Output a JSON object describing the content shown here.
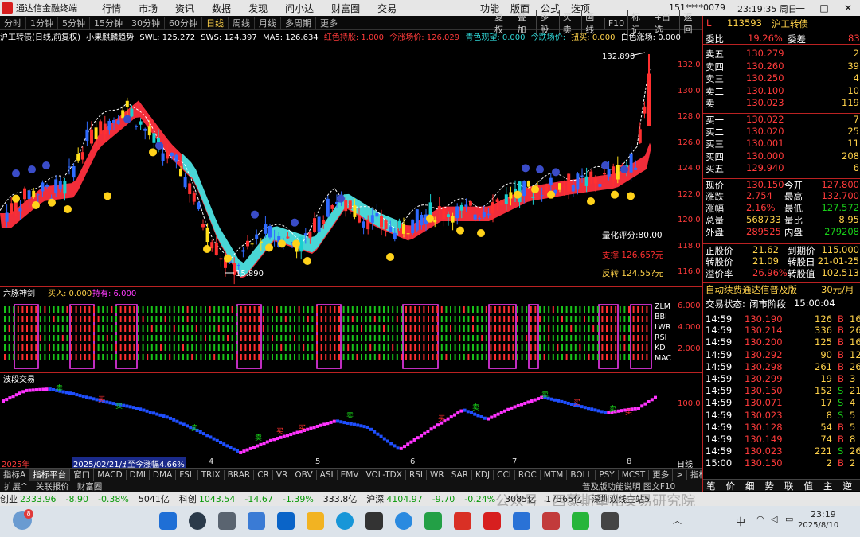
{
  "window": {
    "title": "通达信金融终端",
    "menus": [
      "行情",
      "市场",
      "资讯",
      "数据",
      "发现",
      "问小达",
      "财富圈",
      "交易"
    ],
    "right_menus": [
      "功能",
      "版面",
      "公式",
      "选项"
    ],
    "account": "151****0079",
    "clock": "23:19:35 周日",
    "win_buttons": [
      "—",
      "□",
      "✕"
    ]
  },
  "periods": {
    "items": [
      "分时",
      "1分钟",
      "5分钟",
      "15分钟",
      "30分钟",
      "60分钟",
      "日线",
      "周线",
      "月线",
      "多周期",
      "更多"
    ],
    "active_index": 6,
    "tools": [
      "复权",
      "叠加",
      "多股",
      "买卖",
      "画线",
      "F10",
      "标记",
      "+自选",
      "返回"
    ]
  },
  "kinfo": {
    "name": "沪工转债(日线,前复权)",
    "indicator": "小果麒麟趋势",
    "swl": "SWL: 125.272",
    "sws": "SWS: 124.397",
    "ma5": "MA5: 126.634",
    "red_label": "红色持股: 1.000",
    "cur_label": "今涨场价: 126.029",
    "blue_label": "青色观望: 0.000",
    "cyan_label": "今跌场价:",
    "attack": "扭买: 0.000",
    "white_label": "白色涨场: 0.000"
  },
  "main_chart": {
    "high_label": "132.890",
    "low_label": "15.890",
    "score": "量化评分:80.00",
    "support": "支撑 126.65?元",
    "resist": "反转 124.55?元",
    "yticks": [
      "132.0",
      "130.0",
      "128.0",
      "126.0",
      "124.0",
      "122.0",
      "120.0",
      "118.0",
      "116.0"
    ]
  },
  "sub1": {
    "title": "六脉神剑",
    "buy": "买入: 0.000",
    "hold": "持有: 6.000",
    "labels": [
      "ZLM",
      "BBI",
      "LWR",
      "RSI",
      "KD",
      "MAC"
    ],
    "yticks": [
      "6.000",
      "4.000",
      "2.000"
    ]
  },
  "sub2": {
    "title": "波段交易",
    "yticks": [
      "100.0"
    ],
    "buy_char": "买",
    "sell_char": "卖"
  },
  "datebar": {
    "year": "2025年",
    "cursor": "2025/02/21/五",
    "change": "至今涨幅4.66%",
    "months": [
      "4",
      "5",
      "6",
      "7",
      "8"
    ],
    "period_label": "日线"
  },
  "tabs": [
    "指标A",
    "指标平台",
    "窗口",
    "MACD",
    "DMI",
    "DMA",
    "FSL",
    "TRIX",
    "BRAR",
    "CR",
    "VR",
    "OBV",
    "ASI",
    "EMV",
    "VOL-TDX",
    "RSI",
    "WR",
    "SAR",
    "KDJ",
    "CCI",
    "ROC",
    "MTM",
    "BOLL",
    "PSY",
    "MCST",
    "更多",
    ">",
    "指标B",
    "模板",
    "+",
    "-"
  ],
  "bottom_tabs": [
    "扩展^",
    "关联报价",
    "财富圈"
  ],
  "bottom_right": "普及版功能说明 图文F10",
  "quote": {
    "code": "113593",
    "name": "沪工转债",
    "prefix": "L",
    "wb_label": "委比",
    "wb": "19.26%",
    "wc_label": "委差",
    "wc": "83",
    "asks": [
      {
        "label": "卖五",
        "price": "130.279",
        "vol": "2"
      },
      {
        "label": "卖四",
        "price": "130.260",
        "vol": "39"
      },
      {
        "label": "卖三",
        "price": "130.250",
        "vol": "4"
      },
      {
        "label": "卖二",
        "price": "130.100",
        "vol": "10"
      },
      {
        "label": "卖一",
        "price": "130.023",
        "vol": "119"
      }
    ],
    "bids": [
      {
        "label": "买一",
        "price": "130.022",
        "vol": "7"
      },
      {
        "label": "买二",
        "price": "130.020",
        "vol": "25"
      },
      {
        "label": "买三",
        "price": "130.001",
        "vol": "11"
      },
      {
        "label": "买四",
        "price": "130.000",
        "vol": "208"
      },
      {
        "label": "买五",
        "price": "129.940",
        "vol": "6"
      }
    ],
    "stats": [
      {
        "l1": "现价",
        "v1": "130.150",
        "l2": "今开",
        "v2": "127.800"
      },
      {
        "l1": "涨跌",
        "v1": "2.754",
        "l2": "最高",
        "v2": "132.700"
      },
      {
        "l1": "涨幅",
        "v1": "2.16%",
        "l2": "最低",
        "v2": "127.572"
      },
      {
        "l1": "总量",
        "v1": "568733",
        "l2": "量比",
        "v2": "8.95"
      },
      {
        "l1": "外盘",
        "v1": "289525",
        "l2": "内盘",
        "v2": "279208"
      }
    ],
    "bond": [
      {
        "l1": "正股价",
        "v1": "21.62",
        "l2": "到期价",
        "v2": "115.000"
      },
      {
        "l1": "转股价",
        "v1": "21.09",
        "l2": "转股日",
        "v2": "21-01-25"
      },
      {
        "l1": "溢价率",
        "v1": "26.96%",
        "l2": "转股值",
        "v2": "102.513"
      }
    ],
    "promo": "自动续费通达信普及版",
    "promo_price": "30元/月",
    "trade_state_label": "交易状态:",
    "trade_state": "闭市阶段",
    "trade_time": "15:00:04",
    "ticks": [
      {
        "t": "14:59",
        "p": "130.190",
        "v": "126",
        "s": "B",
        "x": "16"
      },
      {
        "t": "14:59",
        "p": "130.214",
        "v": "336",
        "s": "B",
        "x": "26"
      },
      {
        "t": "14:59",
        "p": "130.200",
        "v": "125",
        "s": "B",
        "x": "16"
      },
      {
        "t": "14:59",
        "p": "130.292",
        "v": "90",
        "s": "B",
        "x": "12"
      },
      {
        "t": "14:59",
        "p": "130.298",
        "v": "261",
        "s": "B",
        "x": "26"
      },
      {
        "t": "14:59",
        "p": "130.299",
        "v": "19",
        "s": "B",
        "x": "3"
      },
      {
        "t": "14:59",
        "p": "130.150",
        "v": "152",
        "s": "S",
        "x": "21"
      },
      {
        "t": "14:59",
        "p": "130.071",
        "v": "17",
        "s": "S",
        "x": "4"
      },
      {
        "t": "14:59",
        "p": "130.023",
        "v": "8",
        "s": "S",
        "x": "5"
      },
      {
        "t": "14:59",
        "p": "130.128",
        "v": "54",
        "s": "B",
        "x": "5"
      },
      {
        "t": "14:59",
        "p": "130.149",
        "v": "74",
        "s": "B",
        "x": "8"
      },
      {
        "t": "14:59",
        "p": "130.023",
        "v": "221",
        "s": "S",
        "x": "26"
      },
      {
        "t": "15:00",
        "p": "130.150",
        "v": "2",
        "s": "B",
        "x": "2"
      }
    ],
    "bottom_tabs": [
      "笔",
      "价",
      "细",
      "势",
      "联",
      "值",
      "主",
      "逆"
    ]
  },
  "statusbar": {
    "items": [
      {
        "label": "创业",
        "val": "2333.96"
      },
      {
        "label": "",
        "val": "-8.90"
      },
      {
        "label": "",
        "val": "-0.38%"
      },
      {
        "label": "",
        "val": "5041亿"
      },
      {
        "label": "科创",
        "val": "1043.54"
      },
      {
        "label": "",
        "val": "-14.67"
      },
      {
        "label": "",
        "val": "-1.39%"
      },
      {
        "label": "",
        "val": "333.8亿"
      },
      {
        "label": "沪深",
        "val": "4104.97"
      },
      {
        "label": "",
        "val": "-9.70"
      },
      {
        "label": "",
        "val": "-0.24%"
      },
      {
        "label": "",
        "val": "3085亿"
      },
      {
        "label": "",
        "val": "17365亿"
      },
      {
        "label": "",
        "val": "深圳双线主站5"
      }
    ],
    "watermark": "公众号 · 西蒙斯量化交易研究院"
  },
  "taskbar": {
    "time": "23:19",
    "date": "2025/8/10",
    "ime": "中",
    "badge": "8"
  }
}
